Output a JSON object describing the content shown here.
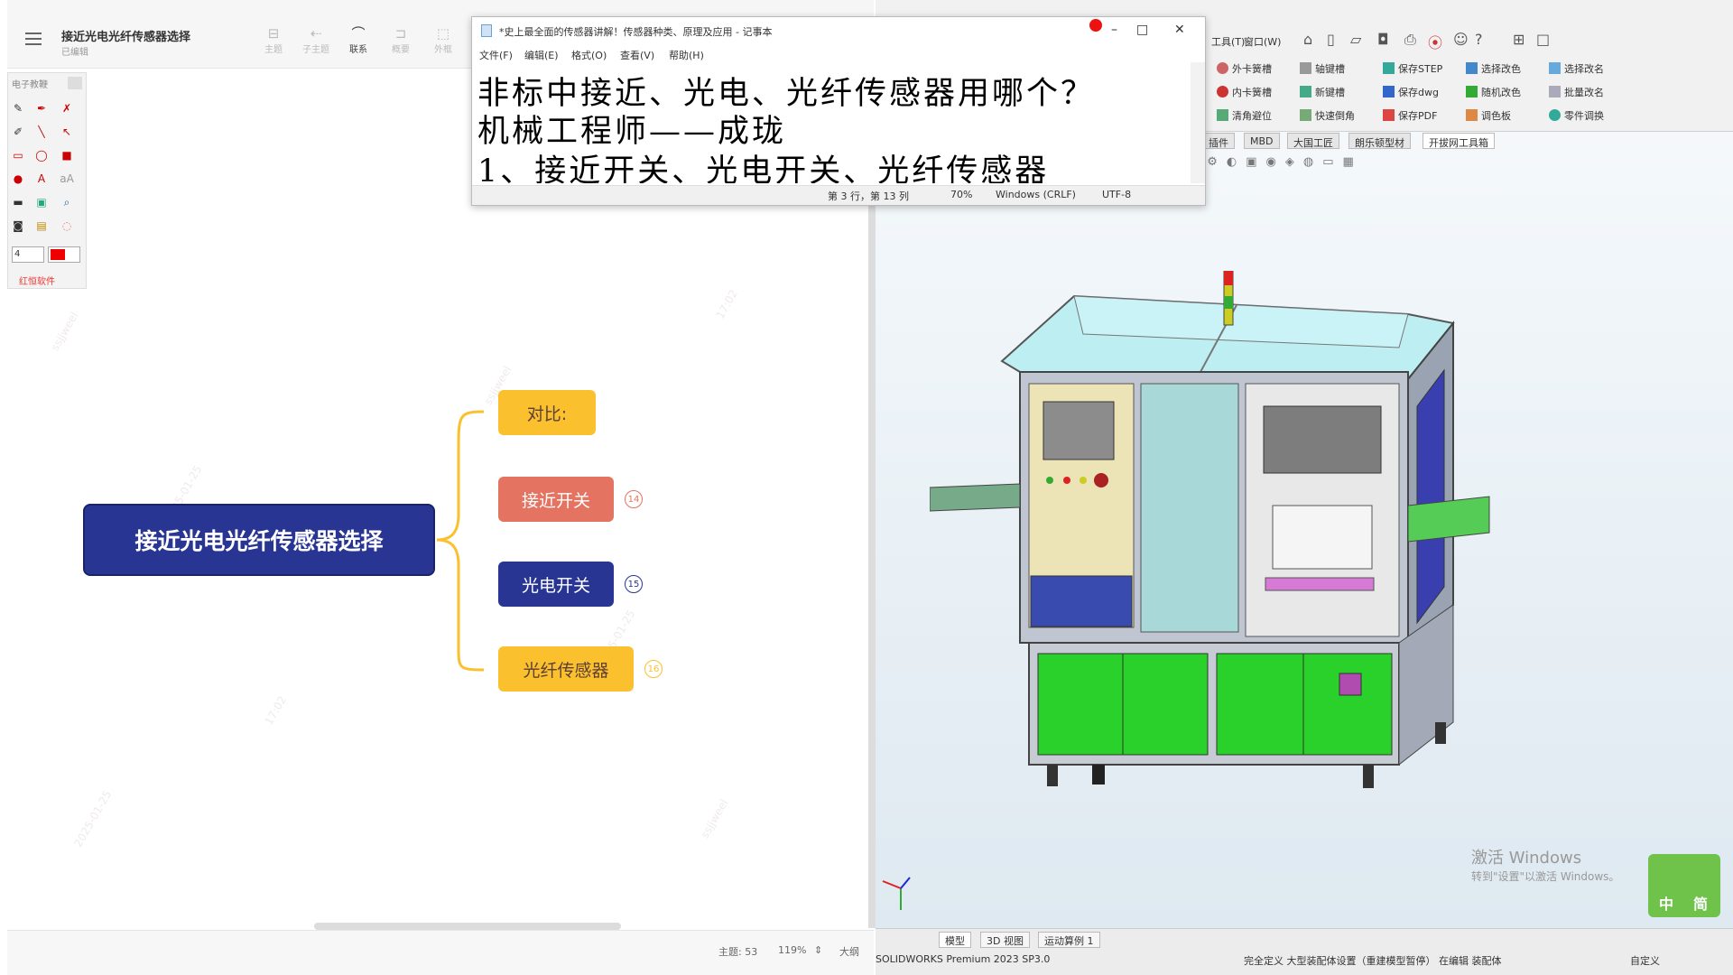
{
  "mindmap": {
    "title": "接近光电光纤传感器选择",
    "subtitle": "已编辑",
    "toolbar": [
      {
        "label": "主题",
        "icon": "topic-icon"
      },
      {
        "label": "子主题",
        "icon": "subtopic-icon"
      },
      {
        "label": "联系",
        "icon": "relation-icon"
      },
      {
        "label": "概要",
        "icon": "summary-icon"
      },
      {
        "label": "外框",
        "icon": "boundary-icon"
      }
    ],
    "pen_panel": {
      "title": "电子教鞭",
      "size_value": "4",
      "footer": "红恒软件"
    },
    "root_node": "接近光电光纤传感器选择",
    "branches": [
      {
        "label": "对比:",
        "badge": "",
        "color": "#fbc02d",
        "text_color": "#5d4037"
      },
      {
        "label": "接近开关",
        "badge": "14",
        "color": "#e57361",
        "text_color": "#ffffff"
      },
      {
        "label": "光电开关",
        "badge": "15",
        "color": "#283593",
        "text_color": "#ffffff"
      },
      {
        "label": "光纤传感器",
        "badge": "16",
        "color": "#fbc02d",
        "text_color": "#5d4037"
      }
    ],
    "status": {
      "topics": "主题: 53",
      "zoom": "119%",
      "outline": "大纲"
    },
    "watermarks": [
      "ssjjweel",
      "2025-01-25",
      "17:02"
    ]
  },
  "notepad": {
    "title": "*史上最全面的传感器讲解！传感器种类、原理及应用 - 记事本",
    "menu": [
      "文件(F)",
      "编辑(E)",
      "格式(O)",
      "查看(V)",
      "帮助(H)"
    ],
    "lines": [
      "非标中接近、光电、光纤传感器用哪个？",
      "机械工程师——成珑",
      "1、接近开关、光电开关、光纤传感器"
    ],
    "status": {
      "position": "第 3 行，第 13 列",
      "zoom": "70%",
      "eol": "Windows (CRLF)",
      "encoding": "UTF-8"
    }
  },
  "solidworks": {
    "menu": [
      "工具(T)",
      "窗口(W)"
    ],
    "ribbon": [
      [
        "外卡簧槽",
        "轴键槽",
        "保存STEP",
        "选择改色",
        "选择改名"
      ],
      [
        "内卡簧槽",
        "新键槽",
        "保存dwg",
        "随机改色",
        "批量改名"
      ],
      [
        "清角避位",
        "快速倒角",
        "保存PDF",
        "调色板",
        "零件调换"
      ]
    ],
    "tabs": [
      "插件",
      "MBD",
      "大国工匠",
      "朗乐顿型材",
      "开拔网工具箱"
    ],
    "bottom_tabs": [
      "模型",
      "3D 视图",
      "运动算例 1"
    ],
    "status_left": "SOLIDWORKS Premium 2023 SP3.0",
    "status_mid": "完全定义  大型装配体设置（重建模型暂停）  在编辑 装配体",
    "status_right": "自定义",
    "activate": {
      "line1": "激活 Windows",
      "line2": "转到\"设置\"以激活 Windows。"
    },
    "ime": {
      "lang": "中",
      "mode": "简"
    }
  }
}
